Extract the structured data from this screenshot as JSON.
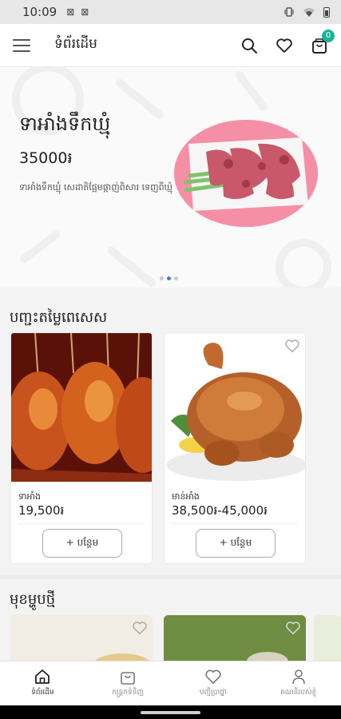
{
  "status_bar": {
    "time": "10:09",
    "notif_icons": [
      "mail-icon",
      "mail-icon"
    ],
    "right_icons": [
      "vibrate-icon",
      "wifi-icon",
      "battery-icon"
    ]
  },
  "app_bar": {
    "title": "ទំព័រដើម",
    "cart_count": "0"
  },
  "banner": {
    "product_name": "ទាអាំងទឹកឃ្មុំ",
    "price": "35000៛",
    "description": "ទាអាំងទឹកឃ្មុំ សេដាតិផ្អែមផ្កាញ់ពិសារ ទេញពីឃ្មុំ",
    "slides": 3,
    "active_slide": 2
  },
  "special_section": {
    "title": "បញ្ជះតម្លៃពេសេស",
    "products": [
      {
        "name": "ទាអាំង",
        "price": "19,500៛",
        "add_label": "+ បន្ថែម"
      },
      {
        "name": "មាន់អាំង",
        "price": "38,500៛-45,000៛",
        "add_label": "+ បន្ថែម"
      }
    ]
  },
  "new_section": {
    "title": "មុខម្ហូបថ្មី"
  },
  "bottom_nav": [
    {
      "label": "ទំព័រដើម",
      "icon": "home-icon",
      "active": true
    },
    {
      "label": "កន្ត្រកទំនិញ",
      "icon": "cart-icon",
      "active": false
    },
    {
      "label": "បញ្ជីប្រាថ្នា",
      "icon": "heart-icon",
      "active": false
    },
    {
      "label": "គណនីរបស់ខ្ញុំ",
      "icon": "user-icon",
      "active": false
    }
  ],
  "colors": {
    "accent": "#19b39a",
    "active_dot": "#2e7fe8",
    "banner_circle": "#f58fa6"
  }
}
